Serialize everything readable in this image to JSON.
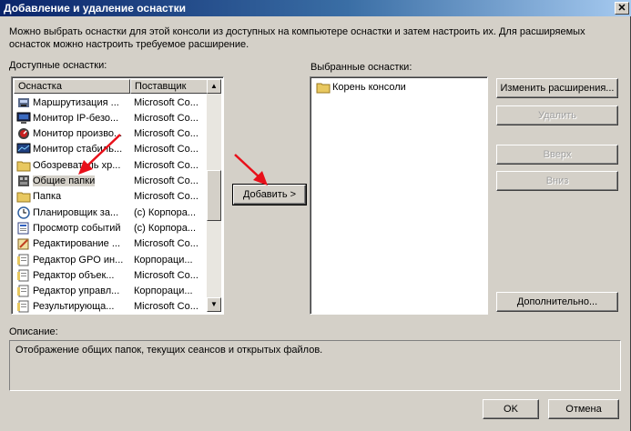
{
  "window": {
    "title": "Добавление и удаление оснастки",
    "close_glyph": "✕"
  },
  "intro_text": "Можно выбрать оснастки для этой консоли из доступных на компьютере оснастки и затем настроить их. Для расширяемых оснасток можно настроить требуемое расширение.",
  "available": {
    "label": "Доступные оснастки:",
    "columns": [
      "Оснастка",
      "Поставщик"
    ],
    "rows": [
      {
        "name": "Маршрутизация ...",
        "vendor": "Microsoft Co...",
        "icon": "routing-icon"
      },
      {
        "name": "Монитор IP-безо...",
        "vendor": "Microsoft Co...",
        "icon": "ipsec-monitor-icon"
      },
      {
        "name": "Монитор произво...",
        "vendor": "Microsoft Co...",
        "icon": "performance-monitor-icon"
      },
      {
        "name": "Монитор стабиль...",
        "vendor": "Microsoft Co...",
        "icon": "reliability-monitor-icon"
      },
      {
        "name": "Обозреватель хр...",
        "vendor": "Microsoft Co...",
        "icon": "folder-icon"
      },
      {
        "name": "Общие папки",
        "vendor": "Microsoft Co...",
        "icon": "shared-folders-icon",
        "selected": true
      },
      {
        "name": "Папка",
        "vendor": "Microsoft Co...",
        "icon": "folder-icon"
      },
      {
        "name": "Планировщик за...",
        "vendor": "(c) Корпора...",
        "icon": "task-scheduler-icon"
      },
      {
        "name": "Просмотр событий",
        "vendor": "(c) Корпора...",
        "icon": "event-viewer-icon"
      },
      {
        "name": "Редактирование ...",
        "vendor": "Microsoft Co...",
        "icon": "editor-icon"
      },
      {
        "name": "Редактор GPO ин...",
        "vendor": "Корпораци...",
        "icon": "document-icon"
      },
      {
        "name": "Редактор объек...",
        "vendor": "Microsoft Co...",
        "icon": "document-icon"
      },
      {
        "name": "Редактор управл...",
        "vendor": "Корпораци...",
        "icon": "document-icon"
      },
      {
        "name": "Результирующа...",
        "vendor": "Microsoft Co...",
        "icon": "document-icon"
      }
    ]
  },
  "add_button": "Добавить >",
  "selected": {
    "label": "Выбранные оснастки:",
    "items": [
      {
        "name": "Корень консоли",
        "icon": "folder-icon"
      }
    ]
  },
  "buttons": {
    "edit_extensions": "Изменить расширения...",
    "remove": "Удалить",
    "up": "Вверх",
    "down": "Вниз",
    "advanced": "Дополнительно...",
    "ok": "OK",
    "cancel": "Отмена"
  },
  "description": {
    "label": "Описание:",
    "text": "Отображение общих папок, текущих сеансов и открытых файлов."
  },
  "colors": {
    "title_start": "#0a246a",
    "title_end": "#a6caf0",
    "face": "#d4d0c8",
    "arrow": "#e8101a"
  }
}
